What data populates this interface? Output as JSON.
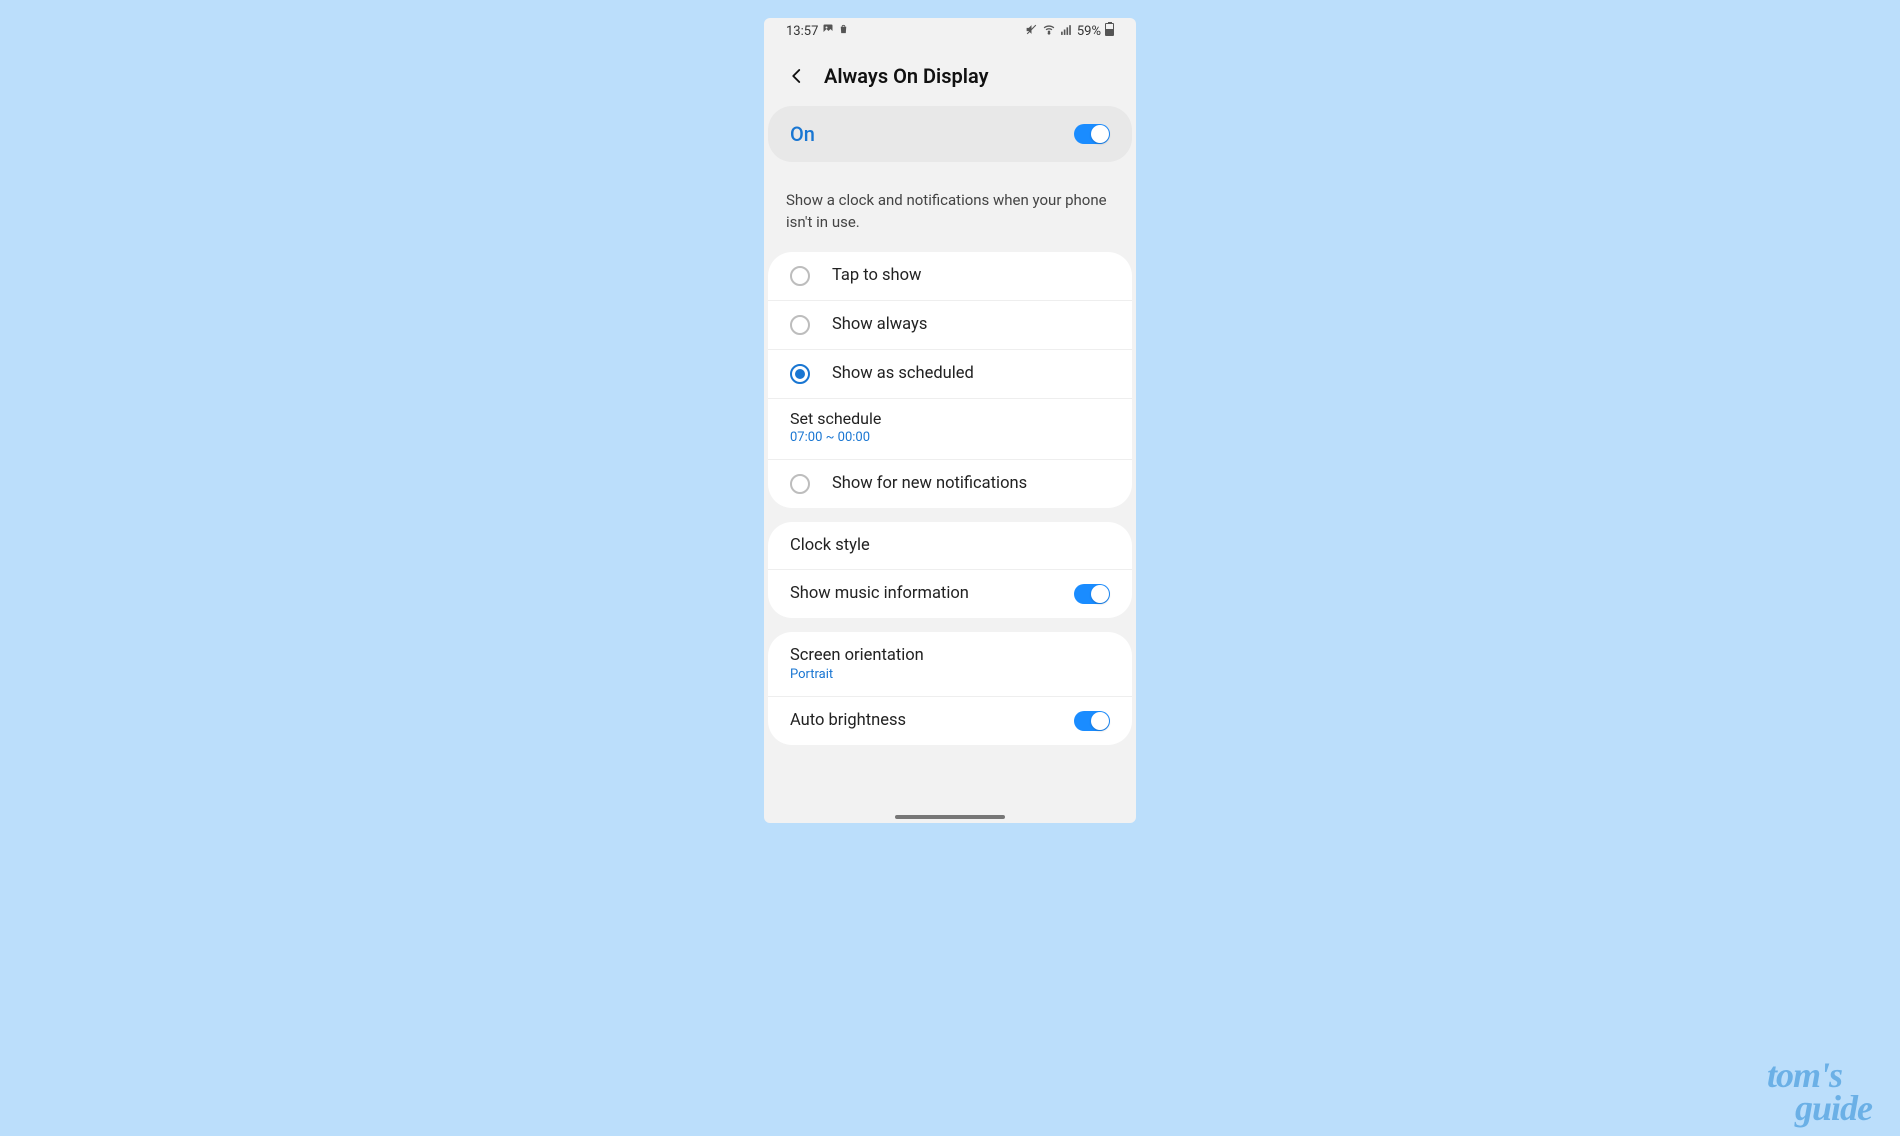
{
  "statusbar": {
    "time": "13:57",
    "battery_pct": "59%"
  },
  "header": {
    "title": "Always On Display"
  },
  "master": {
    "label": "On",
    "enabled": true
  },
  "description": "Show a clock and notifications when your phone isn't in use.",
  "modes": {
    "items": [
      {
        "label": "Tap to show",
        "selected": false
      },
      {
        "label": "Show always",
        "selected": false
      },
      {
        "label": "Show as scheduled",
        "selected": true
      }
    ],
    "schedule": {
      "label": "Set schedule",
      "value": "07:00 ~ 00:00"
    },
    "extra": {
      "label": "Show for new notifications",
      "selected": false
    }
  },
  "settings": {
    "clock_style": "Clock style",
    "music_info": {
      "label": "Show music information",
      "enabled": true
    },
    "screen_orientation": {
      "label": "Screen orientation",
      "value": "Portrait"
    },
    "auto_brightness": {
      "label": "Auto brightness",
      "enabled": true
    }
  },
  "watermark": {
    "line1": "tom's",
    "line2": "guide"
  }
}
